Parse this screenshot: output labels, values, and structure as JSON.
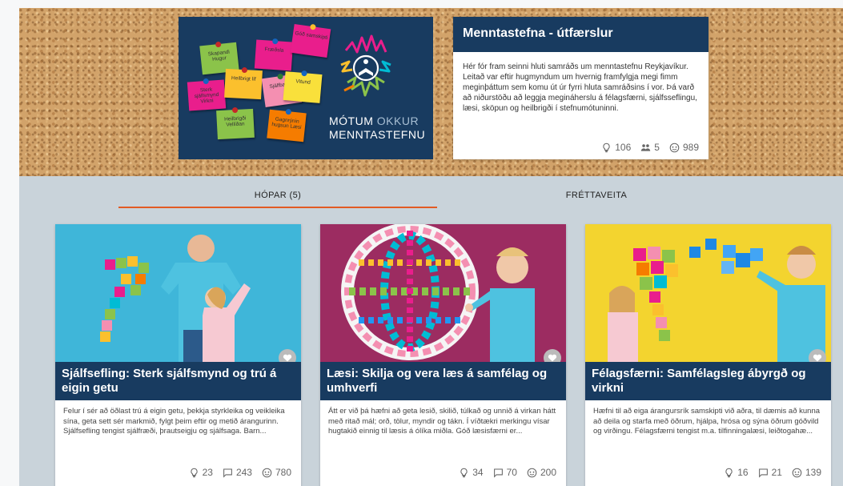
{
  "banner": {
    "notes": [
      {
        "text": "Skapandi Hugur",
        "color": "#8bc34a"
      },
      {
        "text": "Fræðsla",
        "color": "#e91e8c"
      },
      {
        "text": "Góð samskipti",
        "color": "#e91e8c"
      },
      {
        "text": "Sterk sjálfsmynd Virkni",
        "color": "#e91e8c"
      },
      {
        "text": "Heilbrigt líf",
        "color": "#fbc02d"
      },
      {
        "text": "Sjálfbærni",
        "color": "#f48fb1"
      },
      {
        "text": "Vitund",
        "color": "#f9e03b"
      },
      {
        "text": "Heilbrigði Vellíðan",
        "color": "#8bc34a"
      },
      {
        "text": "Gagnrýnin hugsun Læsi",
        "color": "#f57c00"
      }
    ],
    "title_strong": "MÓTUM",
    "title_light": "OKKUR",
    "title_line2": "MENNTASTEFNU"
  },
  "info": {
    "title": "Menntastefna - útfærslur",
    "body": "Hér fór fram seinni hluti samráðs um menntastefnu Reykjavíkur. Leitað var eftir hugmyndum um hvernig framfylgja megi fimm meginþáttum sem komu út úr fyrri hluta samráðsins í vor. Þá varð að niðurstöðu að leggja megináherslu á félagsfærni, sjálfsseflingu, læsi, sköpun og heilbrigði í stefnumótuninni.",
    "ideas": "106",
    "members": "5",
    "views": "989"
  },
  "tabs": {
    "groups": "HÓPAR (5)",
    "feed": "FRÉTTAVEITA"
  },
  "cards": [
    {
      "title": "Sjálfsefling: Sterk sjálfsmynd og trú á eigin getu",
      "desc": "Felur í sér að öðlast trú á eigin getu, þekkja styrkleika og veikleika sína, geta sett sér markmið, fylgt þeim eftir og metið árangurinn. Sjálfsefling tengist sjálfræði, þrautseigju og sjálfsaga. Barn...",
      "ideas": "23",
      "comments": "243",
      "views": "780",
      "bg": "#3fb6d9"
    },
    {
      "title": "Læsi: Skilja og vera læs á samfélag og umhverfi",
      "desc": "Átt er við þá hæfni að geta lesið, skilið, túlkað og unnið á virkan hátt með ritað mál; orð, tölur, myndir og tákn. Í víðtækri merkingu vísar hugtakið einnig til læsis á ólíka miðla. Góð læsisfærni er...",
      "ideas": "34",
      "comments": "70",
      "views": "200",
      "bg": "#9c2c61"
    },
    {
      "title": "Félagsfærni: Samfélagsleg ábyrgð og virkni",
      "desc": "Hæfni til að eiga árangursrík samskipti við aðra, til dæmis að kunna að deila og starfa með öðrum, hjálpa, hrósa og sýna öðrum góðvild og virðingu. Félagsfærni tengist m.a. tilfinningalæsi, leiðtogahæ...",
      "ideas": "16",
      "comments": "21",
      "views": "139",
      "bg": "#f3d42f"
    }
  ],
  "colors": {
    "navy": "#183b60",
    "accent": "#e25b23",
    "content_bg": "#c9d3da"
  }
}
